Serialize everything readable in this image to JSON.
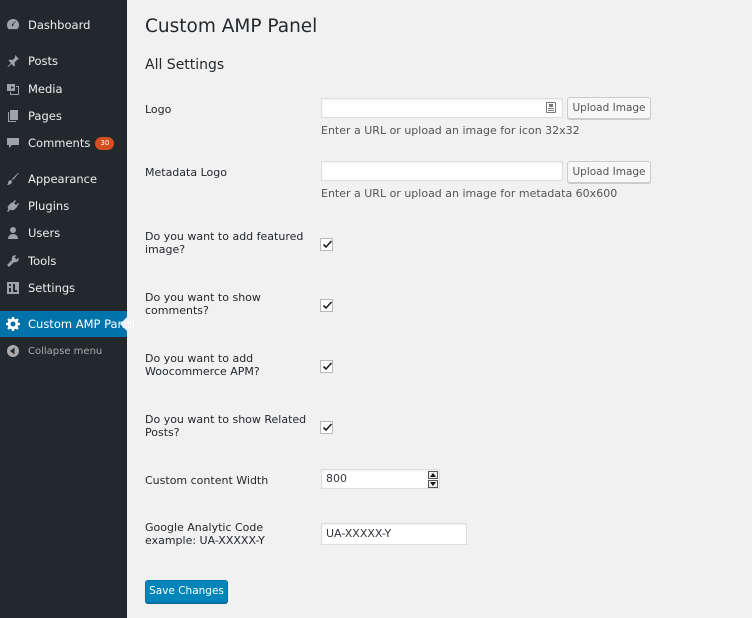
{
  "sidebar": {
    "items": [
      {
        "label": "Dashboard",
        "icon": "dashboard-icon"
      },
      {
        "label": "Posts",
        "icon": "pin-icon"
      },
      {
        "label": "Media",
        "icon": "media-icon"
      },
      {
        "label": "Pages",
        "icon": "pages-icon"
      },
      {
        "label": "Comments",
        "icon": "comment-icon",
        "badge": "30"
      },
      {
        "label": "Appearance",
        "icon": "brush-icon"
      },
      {
        "label": "Plugins",
        "icon": "plug-icon"
      },
      {
        "label": "Users",
        "icon": "user-icon"
      },
      {
        "label": "Tools",
        "icon": "wrench-icon"
      },
      {
        "label": "Settings",
        "icon": "settings-icon"
      },
      {
        "label": "Custom AMP Panel",
        "icon": "gear-icon",
        "active": true
      },
      {
        "label": "Collapse menu",
        "icon": "collapse-icon"
      }
    ]
  },
  "page": {
    "title": "Custom AMP Panel",
    "section": "All Settings"
  },
  "form": {
    "logo": {
      "label": "Logo",
      "value": "",
      "button": "Upload Image",
      "description": "Enter a URL or upload an image for icon 32x32"
    },
    "metadata_logo": {
      "label": "Metadata Logo",
      "value": "",
      "button": "Upload Image",
      "description": "Enter a URL or upload an image for metadata 60x600"
    },
    "featured_image": {
      "label": "Do you want to add featured image?",
      "checked": true
    },
    "show_comments": {
      "label": "Do you want to show comments?",
      "checked": true
    },
    "woocommerce": {
      "label": "Do you want to add Woocommerce APM?",
      "checked": true
    },
    "related_posts": {
      "label": "Do you want to show Related Posts?",
      "checked": true
    },
    "content_width": {
      "label": "Custom content Width",
      "value": "800"
    },
    "analytics": {
      "label": "Google Analytic Code example: UA-XXXXX-Y",
      "value": "UA-XXXXX-Y"
    },
    "save_label": "Save Changes"
  },
  "colors": {
    "sidebar_bg": "#23282d",
    "active_bg": "#0073aa",
    "primary_button": "#0085ba",
    "badge": "#d54e21",
    "page_bg": "#f1f1f1"
  }
}
